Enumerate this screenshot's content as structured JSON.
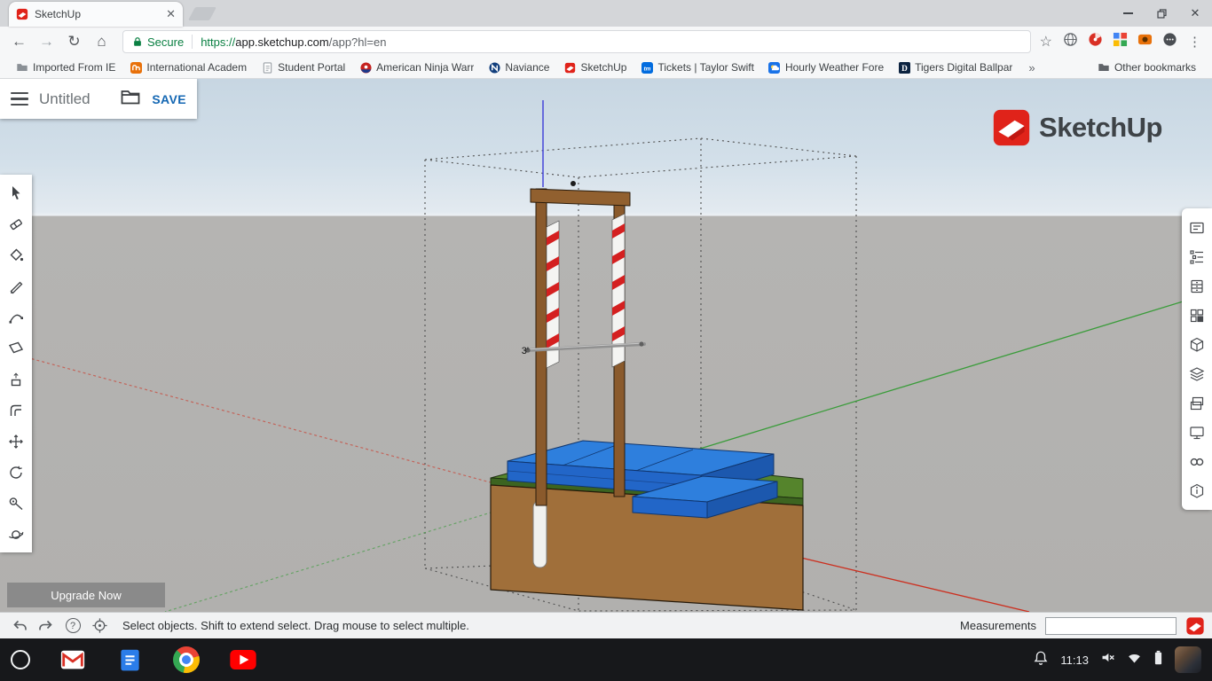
{
  "browser": {
    "tab_title": "SketchUp",
    "address_bar": {
      "secure_label": "Secure",
      "url_scheme": "https://",
      "url_host": "app.sketchup.com",
      "url_rest": "/app?hl=en"
    },
    "bookmarks": [
      {
        "label": "Imported From IE",
        "icon": "folder-icon"
      },
      {
        "label": "International Academ",
        "icon": "academy-favicon"
      },
      {
        "label": "Student Portal",
        "icon": "page-favicon"
      },
      {
        "label": "American Ninja Warr",
        "icon": "ninja-warrior-favicon"
      },
      {
        "label": "Naviance",
        "icon": "naviance-favicon"
      },
      {
        "label": "SketchUp",
        "icon": "sketchup-favicon"
      },
      {
        "label": "Tickets | Taylor Swift",
        "icon": "ticketmaster-favicon",
        "icon_letter": "tm"
      },
      {
        "label": "Hourly Weather Fore",
        "icon": "weather-favicon"
      },
      {
        "label": "Tigers Digital Ballpar",
        "icon": "tigers-favicon",
        "icon_letter": "D"
      }
    ],
    "overflow_chevron": "»",
    "other_bookmarks_label": "Other bookmarks"
  },
  "app": {
    "header": {
      "title": "Untitled",
      "save_label": "SAVE"
    },
    "brand": {
      "logo_text": "SketchUp"
    },
    "left_toolbar_tools": [
      "select",
      "eraser",
      "paint-bucket",
      "line",
      "2-point-arc",
      "rectangle",
      "push-pull",
      "offset",
      "move",
      "rotate",
      "tape-measure",
      "orbit"
    ],
    "right_toolbar_panels": [
      "entity-info",
      "outliner",
      "components",
      "materials",
      "styles",
      "layers",
      "scenes",
      "display",
      "views",
      "model-info"
    ],
    "upgrade_label": "Upgrade Now",
    "scene": {
      "dimension_label": "3'"
    },
    "status": {
      "hint": "Select objects. Shift to extend select. Drag mouse to select multiple.",
      "help_glyph": "?",
      "measurements_label": "Measurements",
      "measurements_value": ""
    }
  },
  "shelf": {
    "time": "11:13"
  },
  "colors": {
    "sketchup_red": "#e0231a",
    "save_blue": "#1467b3",
    "secure_green": "#0b8043",
    "axis_red": "#cc2f1f",
    "axis_green": "#3a9c3a",
    "axis_blue": "#3c3cd8",
    "mat_blue": "#2e7fdd",
    "grass_green": "#55842c",
    "dirt_brown": "#a06f3a",
    "frame_brown": "#8a5a2c",
    "sky": "#c7d6e2",
    "ground": "#b1b0ae"
  }
}
